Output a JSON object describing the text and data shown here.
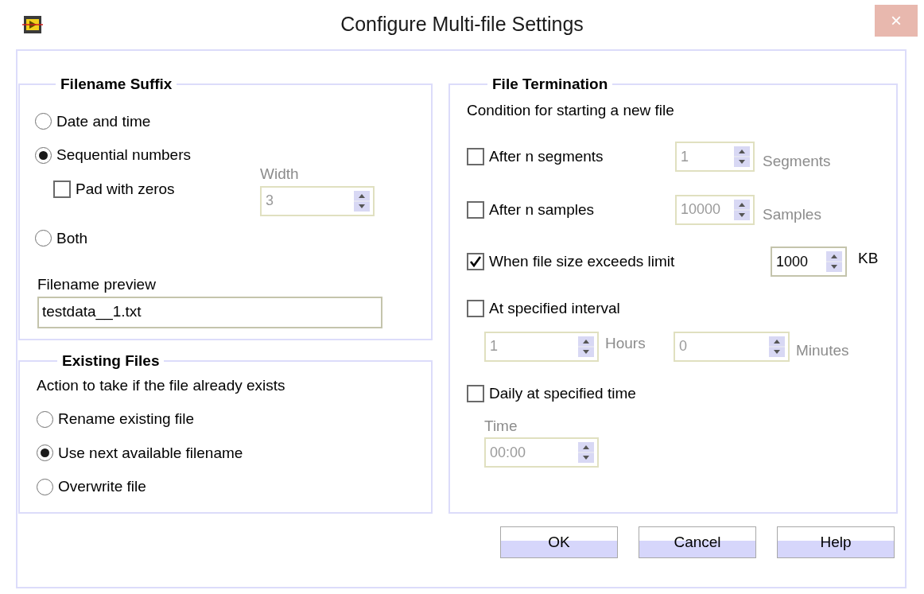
{
  "window": {
    "title": "Configure Multi-file Settings",
    "close": "×"
  },
  "filename_suffix": {
    "title": "Filename Suffix",
    "options": [
      {
        "label": "Date and time",
        "selected": false
      },
      {
        "label": "Sequential numbers",
        "selected": true
      },
      {
        "label": "Both",
        "selected": false
      }
    ],
    "pad_with_zeros": {
      "label": "Pad with zeros",
      "checked": false
    },
    "width": {
      "label": "Width",
      "value": "3",
      "disabled": true
    },
    "preview": {
      "label": "Filename preview",
      "value": "testdata__1.txt"
    }
  },
  "existing_files": {
    "title": "Existing Files",
    "prompt": "Action to take if the file already exists",
    "options": [
      {
        "label": "Rename existing file",
        "selected": false
      },
      {
        "label": "Use next available filename",
        "selected": true
      },
      {
        "label": "Overwrite file",
        "selected": false
      }
    ]
  },
  "file_termination": {
    "title": "File Termination",
    "prompt": "Condition for starting a new file",
    "conditions": [
      {
        "kind": "count",
        "label": "After n segments",
        "checked": false,
        "spinners": [
          {
            "value": "1",
            "unit": "Segments",
            "disabled": true
          }
        ]
      },
      {
        "kind": "count",
        "label": "After n samples",
        "checked": false,
        "spinners": [
          {
            "value": "10000",
            "unit": "Samples",
            "disabled": true
          }
        ]
      },
      {
        "kind": "limit",
        "label": "When file size exceeds limit",
        "checked": true,
        "spinners": [
          {
            "value": "1000",
            "unit": "KB",
            "disabled": false
          }
        ]
      },
      {
        "kind": "interval",
        "label": "At specified interval",
        "checked": false,
        "spinners": [
          {
            "value": "1",
            "unit": "Hours",
            "disabled": true
          },
          {
            "value": "0",
            "unit": "Minutes",
            "disabled": true
          }
        ]
      },
      {
        "kind": "time",
        "label": "Daily at specified time",
        "checked": false,
        "time_label": "Time",
        "spinners": [
          {
            "value": "00:00",
            "disabled": true
          }
        ]
      }
    ]
  },
  "buttons": [
    "OK",
    "Cancel",
    "Help"
  ]
}
